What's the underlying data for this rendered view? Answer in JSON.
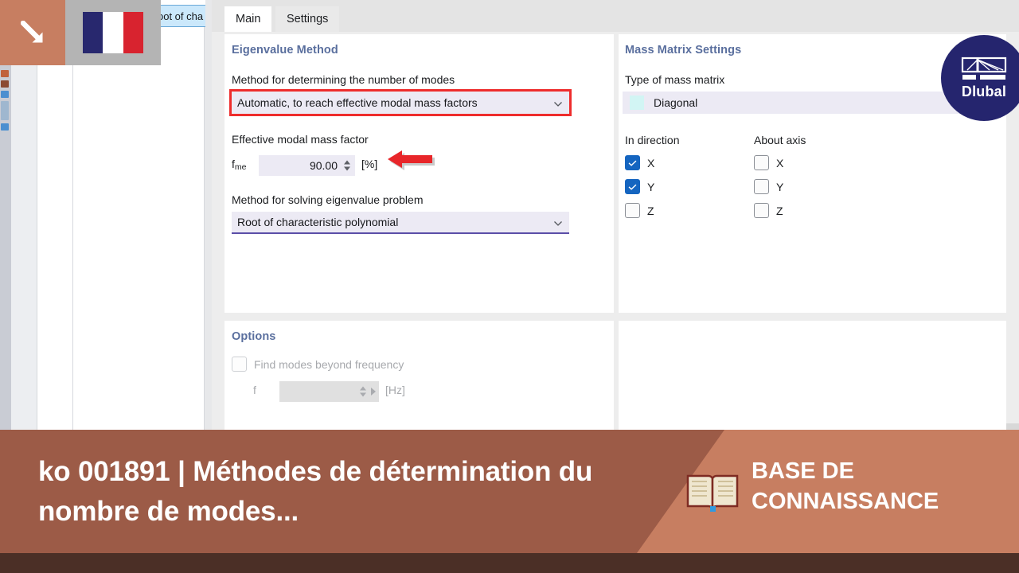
{
  "background": {
    "ghost_dropdown_item": "oot of cha"
  },
  "overlay": {
    "cue_icon": "arrow-down-right-icon",
    "flag": {
      "name": "french-flag",
      "colors": [
        "#28286e",
        "#ffffff",
        "#d8232f"
      ]
    }
  },
  "dialog": {
    "tabs": [
      {
        "label": "Main",
        "active": true
      },
      {
        "label": "Settings",
        "active": false
      }
    ],
    "eigenvalue_method": {
      "title": "Eigenvalue Method",
      "number_of_modes_label": "Method for determining the number of modes",
      "number_of_modes_value": "Automatic, to reach effective modal mass factors",
      "number_of_modes_highlight_color": "#ee2c2c",
      "effective_modal_mass_label": "Effective modal mass factor",
      "fme_symbol": "f",
      "fme_subscript": "me",
      "fme_value": "90.00",
      "fme_unit": "[%]",
      "solving_method_label": "Method for solving eigenvalue problem",
      "solving_method_value": "Root of characteristic polynomial"
    },
    "mass_matrix": {
      "title": "Mass Matrix Settings",
      "type_label": "Type of mass matrix",
      "type_value": "Diagonal",
      "type_swatch_color": "#d2f5f4",
      "in_direction_label": "In direction",
      "about_axis_label": "About axis",
      "in_direction": [
        {
          "label": "X",
          "checked": true
        },
        {
          "label": "Y",
          "checked": true
        },
        {
          "label": "Z",
          "checked": false
        }
      ],
      "about_axis": [
        {
          "label": "X",
          "checked": false
        },
        {
          "label": "Y",
          "checked": false
        },
        {
          "label": "Z",
          "checked": false
        }
      ]
    },
    "options": {
      "title": "Options",
      "find_modes_label": "Find modes beyond frequency",
      "find_modes_checked": false,
      "f_symbol": "f",
      "f_value": "",
      "f_unit": "[Hz]",
      "disabled": true
    }
  },
  "annotation": {
    "pointer_icon": "arrow-left-icon",
    "pointer_color": "#e8262a"
  },
  "logo": {
    "name": "dlubal-logo",
    "text": "Dlubal",
    "circle_color": "#25256e"
  },
  "banner": {
    "title": "ko 001891 | Méthodes de détermination du nombre de modes...",
    "category_line1": "BASE DE",
    "category_line2": "CONNAISSANCE",
    "book_icon": "open-book-icon",
    "bg_color": "#9c5b47",
    "wedge_color": "#c77e61",
    "foot_color": "#4b2f26"
  }
}
